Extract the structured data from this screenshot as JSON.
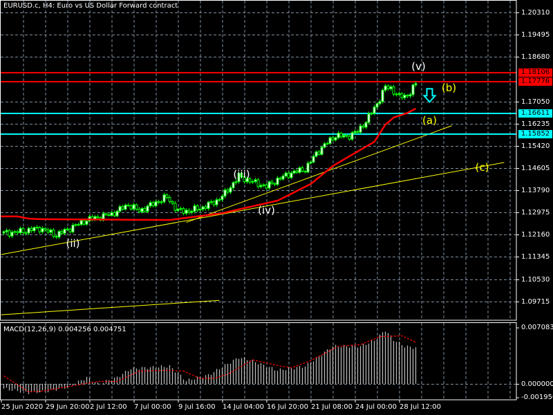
{
  "title": "EURUSD.c, H4:  Euro vs US Dollar Forward contract",
  "macd_title": "MACD(12,26,9) 0.004256 0.004751",
  "colors": {
    "grid": "#8090a0",
    "bull_body": "#ffffff",
    "candle": "#00ff00",
    "ma": "#ff0000",
    "trend": "#ffff00",
    "resistance": "#ff0000",
    "support": "#00ffff",
    "macd_hist": "#c0c0c0",
    "macd_signal": "#ff0000"
  },
  "price_axis": [
    "1.20310",
    "1.19495",
    "1.18680",
    "1.17050",
    "1.16235",
    "1.15420",
    "1.14605",
    "1.13790",
    "1.12975",
    "1.12160",
    "1.11345",
    "1.10530",
    "1.09715"
  ],
  "macd_axis": [
    "0.007083",
    "0.000000",
    "-0.001950"
  ],
  "time_axis": [
    "25 Jun 2020",
    "29 Jun 20:00",
    "2 Jul 12:00",
    "7 Jul 00:00",
    "9 Jul 16:00",
    "14 Jul 04:00",
    "16 Jul 20:00",
    "21 Jul 08:00",
    "24 Jul 00:00",
    "28 Jul 12:00"
  ],
  "hlines": [
    {
      "price": "1.18106",
      "type": "resistance"
    },
    {
      "price": "1.17776",
      "type": "resistance"
    },
    {
      "price": "1.16611",
      "type": "support"
    },
    {
      "price": "1.15852",
      "type": "support"
    }
  ],
  "wave_labels": [
    {
      "text": "(ii)",
      "bar": 25,
      "price": 1.1184,
      "color": "white"
    },
    {
      "text": "(iii)",
      "bar": 86,
      "price": 1.1438,
      "color": "white"
    },
    {
      "text": "(iv)",
      "bar": 95,
      "price": 1.1306,
      "color": "white"
    },
    {
      "text": "(v)",
      "bar": 150,
      "price": 1.1834,
      "color": "white"
    },
    {
      "text": "(b)",
      "bar": 161,
      "price": 1.1755,
      "color": "yellow"
    },
    {
      "text": "(a)",
      "bar": 154,
      "price": 1.1636,
      "color": "yellow"
    },
    {
      "text": "(c)",
      "bar": 173,
      "price": 1.1464,
      "color": "yellow"
    }
  ],
  "arrow": {
    "icon": "down-arrow-icon",
    "bar": 154,
    "price": 1.1726
  },
  "chart_data": {
    "type": "candlestick",
    "symbol": "EURUSD.c",
    "timeframe": "H4",
    "ylim": [
      1.0922,
      1.2075
    ],
    "bars": 150,
    "close_path": [
      [
        0,
        1.1222
      ],
      [
        6,
        1.1227
      ],
      [
        13,
        1.124
      ],
      [
        19,
        1.1214
      ],
      [
        24,
        1.124
      ],
      [
        30,
        1.127
      ],
      [
        39,
        1.1291
      ],
      [
        45,
        1.1326
      ],
      [
        49,
        1.1303
      ],
      [
        59,
        1.1354
      ],
      [
        63,
        1.1303
      ],
      [
        67,
        1.1303
      ],
      [
        72,
        1.1316
      ],
      [
        77,
        1.1341
      ],
      [
        80,
        1.1367
      ],
      [
        85,
        1.143
      ],
      [
        89,
        1.1413
      ],
      [
        95,
        1.1392
      ],
      [
        99,
        1.1418
      ],
      [
        104,
        1.1443
      ],
      [
        109,
        1.1456
      ],
      [
        113,
        1.1514
      ],
      [
        116,
        1.1545
      ],
      [
        120,
        1.158
      ],
      [
        124,
        1.1575
      ],
      [
        128,
        1.1595
      ],
      [
        131,
        1.1633
      ],
      [
        135,
        1.1697
      ],
      [
        138,
        1.1758
      ],
      [
        140,
        1.1753
      ],
      [
        143,
        1.1722
      ],
      [
        146,
        1.1727
      ],
      [
        149,
        1.1768
      ]
    ],
    "moving_average": [
      [
        0,
        1.1283
      ],
      [
        5,
        1.1283
      ],
      [
        9,
        1.1275
      ],
      [
        13,
        1.1273
      ],
      [
        60,
        1.127
      ],
      [
        66,
        1.1278
      ],
      [
        74,
        1.1288
      ],
      [
        79,
        1.1295
      ],
      [
        99,
        1.1341
      ],
      [
        111,
        1.1402
      ],
      [
        119,
        1.1468
      ],
      [
        124,
        1.1498
      ],
      [
        134,
        1.1557
      ],
      [
        138,
        1.162
      ],
      [
        141,
        1.1646
      ],
      [
        146,
        1.1663
      ],
      [
        149,
        1.1679
      ]
    ],
    "trendlines": [
      [
        [
          -1,
          1.1143
        ],
        [
          181,
          1.1481
        ]
      ],
      [
        [
          66,
          1.1261
        ],
        [
          162,
          1.1616
        ]
      ],
      [
        [
          -1,
          1.0922
        ],
        [
          78,
          1.0975
        ]
      ]
    ],
    "macd": {
      "ylim": [
        -0.00195,
        0.007083
      ],
      "histogram": [
        [
          0,
          -0.0006
        ],
        [
          9,
          -0.0011
        ],
        [
          16,
          -0.0009
        ],
        [
          24,
          -0.0003
        ],
        [
          30,
          0.0008
        ],
        [
          34,
          0.0
        ],
        [
          41,
          0.0008
        ],
        [
          46,
          0.0019
        ],
        [
          60,
          0.0022
        ],
        [
          66,
          0.0004
        ],
        [
          74,
          0.0011
        ],
        [
          85,
          0.0033
        ],
        [
          89,
          0.003
        ],
        [
          95,
          0.0022
        ],
        [
          99,
          0.0017
        ],
        [
          109,
          0.0022
        ],
        [
          113,
          0.0032
        ],
        [
          119,
          0.0047
        ],
        [
          129,
          0.0047
        ],
        [
          134,
          0.0054
        ],
        [
          138,
          0.0067
        ],
        [
          141,
          0.0055
        ],
        [
          145,
          0.0047
        ],
        [
          149,
          0.0045
        ]
      ],
      "signal": [
        [
          0,
          0.001
        ],
        [
          9,
          -0.001
        ],
        [
          14,
          -0.0009
        ],
        [
          24,
          -0.0003
        ],
        [
          34,
          0.0003
        ],
        [
          41,
          0.0003
        ],
        [
          49,
          0.0016
        ],
        [
          59,
          0.0017
        ],
        [
          65,
          0.0016
        ],
        [
          71,
          0.0007
        ],
        [
          76,
          0.0007
        ],
        [
          81,
          0.0012
        ],
        [
          90,
          0.003
        ],
        [
          99,
          0.0023
        ],
        [
          104,
          0.002
        ],
        [
          111,
          0.0029
        ],
        [
          121,
          0.0047
        ],
        [
          129,
          0.0049
        ],
        [
          136,
          0.0059
        ],
        [
          144,
          0.006
        ],
        [
          149,
          0.0052
        ]
      ]
    }
  }
}
